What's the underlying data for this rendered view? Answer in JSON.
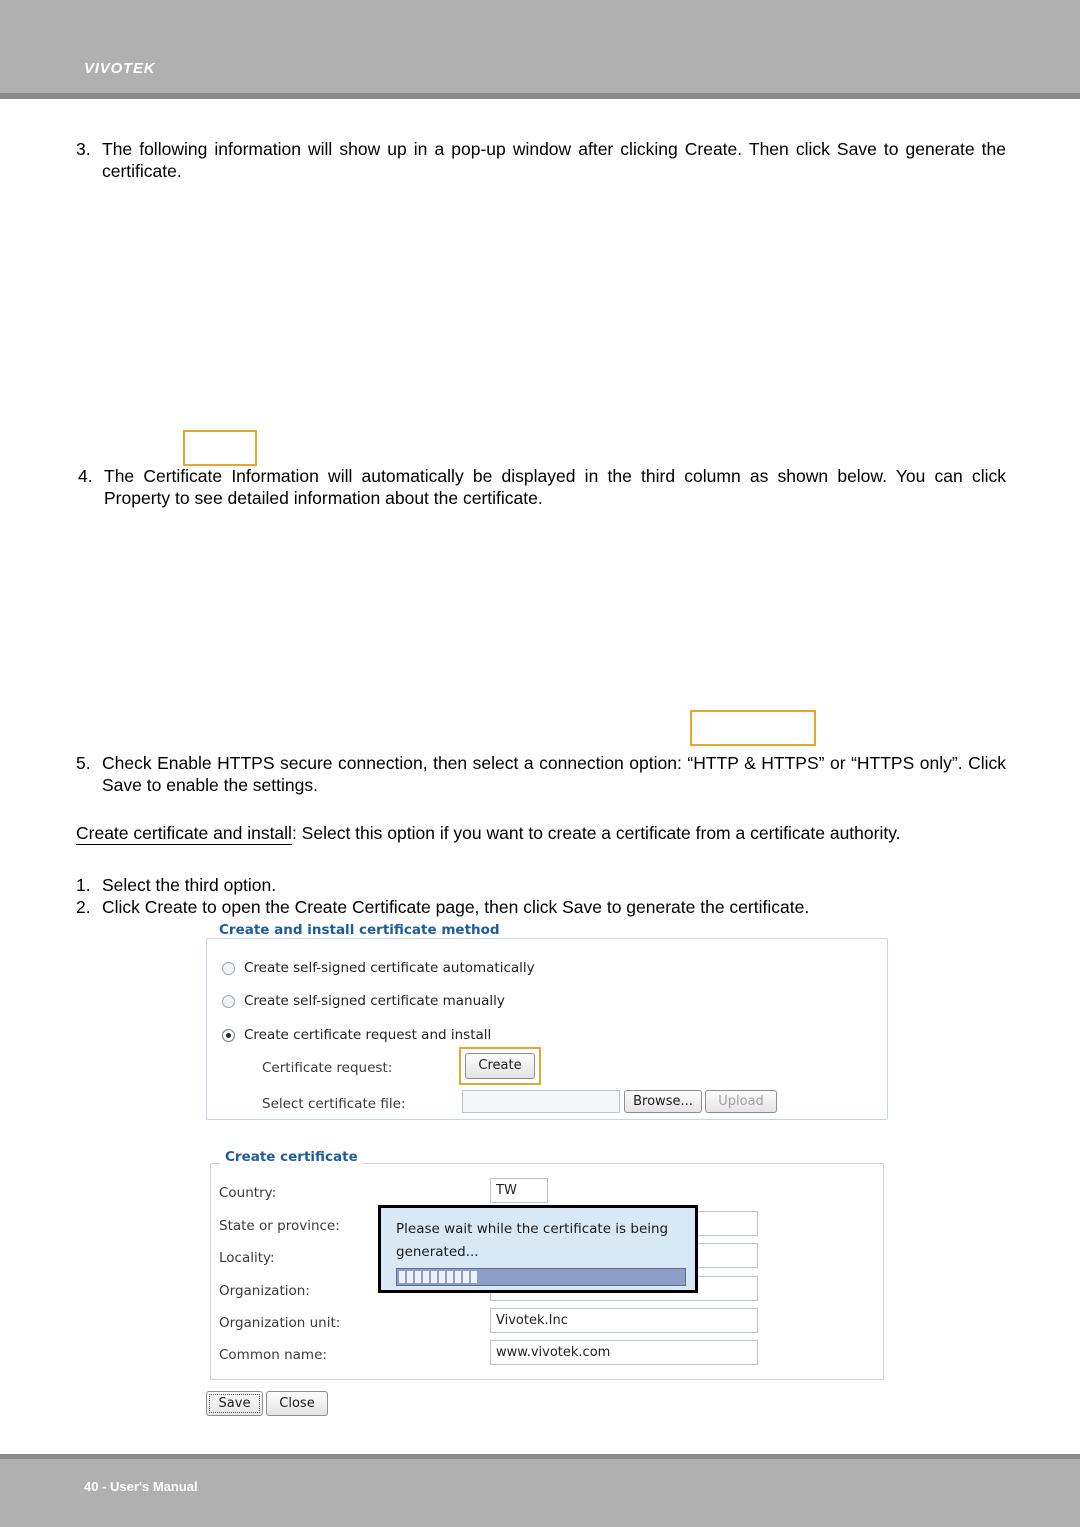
{
  "header": {
    "brand": "VIVOTEK"
  },
  "footer": {
    "text": "40 - User's Manual"
  },
  "steps": {
    "s3_num": "3.",
    "s3_text": "The following information will show up in a pop-up window after clicking Create. Then click Save to generate the certificate.",
    "s4_num": "4.",
    "s4_text": "The Certificate Information will automatically be displayed in the third column as shown below. You can click Property to see detailed information about the certificate.",
    "s5_num": "5.",
    "s5_text": "Check Enable HTTPS secure connection, then select a connection option: “HTTP & HTTPS” or “HTTPS only”. Click Save to enable the settings.",
    "create_install_label": "Create certificate and install",
    "create_install_text": ": Select this option if you want to create a certificate from a certificate authority.",
    "sub1_num": "1.",
    "sub1_text": "Select the third option.",
    "sub2_num": "2.",
    "sub2_text": "Click Create to open the Create Certificate page, then click Save to generate the certificate."
  },
  "panel_method": {
    "legend": "Create and install certificate method",
    "options": [
      "Create self-signed certificate automatically",
      "Create self-signed certificate manually",
      "Create certificate request and install"
    ],
    "selected_index": 2,
    "cert_request_label": "Certificate request:",
    "create_button": "Create",
    "select_file_label": "Select certificate file:",
    "file_value": "",
    "browse_button": "Browse...",
    "upload_button": "Upload"
  },
  "panel_certificate": {
    "legend": "Create certificate",
    "fields": [
      {
        "label": "Country:",
        "value": "TW"
      },
      {
        "label": "State or province:",
        "value": ""
      },
      {
        "label": "Locality:",
        "value": ""
      },
      {
        "label": "Organization:",
        "value": ""
      },
      {
        "label": "Organization unit:",
        "value": "Vivotek.Inc"
      },
      {
        "label": "Common name:",
        "value": "www.vivotek.com"
      }
    ],
    "save_button": "Save",
    "close_button": "Close"
  },
  "dialog": {
    "line1": "Please wait while the certificate is being",
    "line2": "generated..."
  },
  "colors": {
    "header_bg": "#b0b0b0",
    "header_rule": "#8a8a8a",
    "legend_blue": "#1d5c9e",
    "highlight_orange": "#e8a72c",
    "dialog_bg": "#d8e8f5",
    "progress_fill": "#8e9ec6"
  }
}
